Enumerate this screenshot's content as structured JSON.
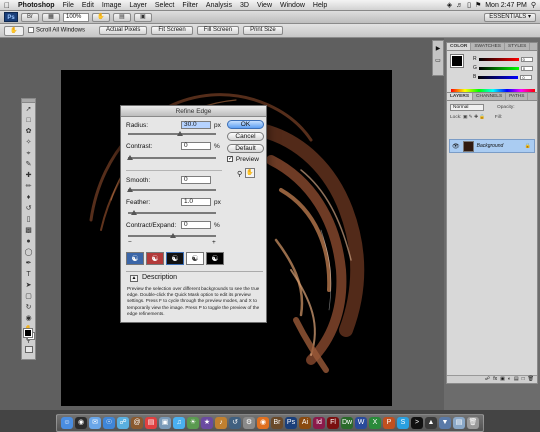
{
  "menubar": {
    "app_name": "Photoshop",
    "items": [
      "File",
      "Edit",
      "Image",
      "Layer",
      "Select",
      "Filter",
      "Analysis",
      "3D",
      "View",
      "Window",
      "Help"
    ],
    "clock": "Mon 2:47 PM"
  },
  "appbar": {
    "logo": "Ps",
    "zoom": "100%",
    "workspace": "ESSENTIALS ▾"
  },
  "options": {
    "scroll_all_windows": "Scroll All Windows",
    "actual_pixels": "Actual Pixels",
    "fit_screen": "Fit Screen",
    "fill_screen": "Fill Screen",
    "print_size": "Print Size"
  },
  "dialog": {
    "title": "Refine Edge",
    "radius_label": "Radius:",
    "radius_value": "30.0",
    "radius_unit": "px",
    "contrast_label": "Contrast:",
    "contrast_value": "0",
    "contrast_unit": "%",
    "smooth_label": "Smooth:",
    "smooth_value": "0",
    "feather_label": "Feather:",
    "feather_value": "1.0",
    "feather_unit": "px",
    "contract_label": "Contract/Expand:",
    "contract_value": "0",
    "contract_unit": "%",
    "minus": "−",
    "plus": "+",
    "ok": "OK",
    "cancel": "Cancel",
    "default": "Default",
    "preview": "Preview",
    "description_label": "Description",
    "description_text": "Preview the selection over different backgrounds to see the true edge. Double-click the Quick Mask option to edit its preview settings. Press F to cycle through the preview modes, and X to temporarily view the image. Press P to toggle the preview of the edge refinements."
  },
  "color_panel": {
    "tabs": [
      "COLOR",
      "SWATCHES",
      "STYLES"
    ],
    "rows": [
      {
        "label": "R",
        "value": "0"
      },
      {
        "label": "G",
        "value": "0"
      },
      {
        "label": "B",
        "value": "0"
      }
    ]
  },
  "layers_panel": {
    "tabs": [
      "LAYERS",
      "CHANNELS",
      "PATHS"
    ],
    "blend_mode": "Normal",
    "opacity": "Opacity:",
    "lock": "Lock:",
    "fill": "Fill:",
    "layer_name": "Background"
  },
  "colors": {
    "accent_blue": "#5e9ff2",
    "layer_highlight": "#aaccf2",
    "hair": "#8a4a2a"
  },
  "icons": {
    "tools": [
      "move-tool-icon",
      "marquee-tool-icon",
      "lasso-tool-icon",
      "quick-select-tool-icon",
      "crop-tool-icon",
      "eyedropper-tool-icon",
      "healing-brush-icon",
      "brush-tool-icon",
      "clone-stamp-icon",
      "history-brush-icon",
      "eraser-tool-icon",
      "gradient-tool-icon",
      "blur-tool-icon",
      "dodge-tool-icon",
      "pen-tool-icon",
      "type-tool-icon",
      "path-select-icon",
      "shape-tool-icon",
      "3d-rotate-icon",
      "3d-orbit-icon",
      "hand-tool-icon",
      "zoom-tool-icon"
    ]
  }
}
